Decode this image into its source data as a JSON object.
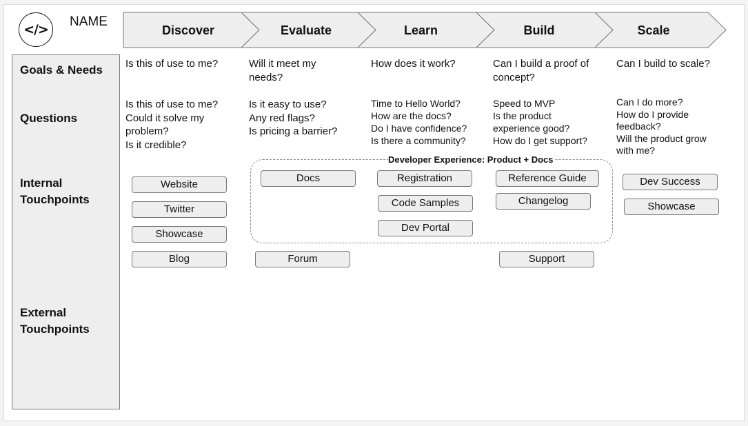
{
  "header": {
    "logo_icon": "code-brackets-icon",
    "logo_glyph": "</>",
    "name": "NAME"
  },
  "stages": [
    {
      "label": "Discover"
    },
    {
      "label": "Evaluate"
    },
    {
      "label": "Learn"
    },
    {
      "label": "Build"
    },
    {
      "label": "Scale"
    }
  ],
  "rows": {
    "goals": "Goals & Needs",
    "questions": "Questions",
    "internal": [
      "Internal",
      "Touchpoints"
    ],
    "external": [
      "External",
      "Touchpoints"
    ]
  },
  "goals": [
    [
      "Is this of use to me?"
    ],
    [
      "Will it meet my",
      "needs?"
    ],
    [
      "How does it work?"
    ],
    [
      "Can I build a proof of",
      "concept?"
    ],
    [
      "Can I build to scale?"
    ]
  ],
  "questions": [
    [
      "Is this of use to me?",
      "Could it solve my",
      "problem?",
      "Is it credible?"
    ],
    [
      "Is it easy to use?",
      "Any red flags?",
      "Is pricing a barrier?"
    ],
    [
      "Time to Hello World?",
      "How are the docs?",
      "Do I have confidence?",
      "Is there a community?"
    ],
    [
      "Speed to MVP",
      "Is the product",
      "experience good?",
      "How do I get support?"
    ],
    [
      "Can I do more?",
      "How do I provide",
      "feedback?",
      "Will the product grow",
      "with me?"
    ]
  ],
  "group": {
    "label": "Developer Experience: Product + Docs"
  },
  "touchpoints": {
    "discover": [
      "Website",
      "Twitter",
      "Showcase",
      "Blog"
    ],
    "evaluate": [
      "Docs",
      "Forum"
    ],
    "learn": [
      "Registration",
      "Code Samples",
      "Dev Portal"
    ],
    "build": [
      "Reference Guide",
      "Changelog",
      "Support"
    ],
    "scale": [
      "Dev Success",
      "Showcase"
    ]
  },
  "colors": {
    "panel_fill": "#eeeeee",
    "stroke": "#777777",
    "text": "#111111"
  }
}
